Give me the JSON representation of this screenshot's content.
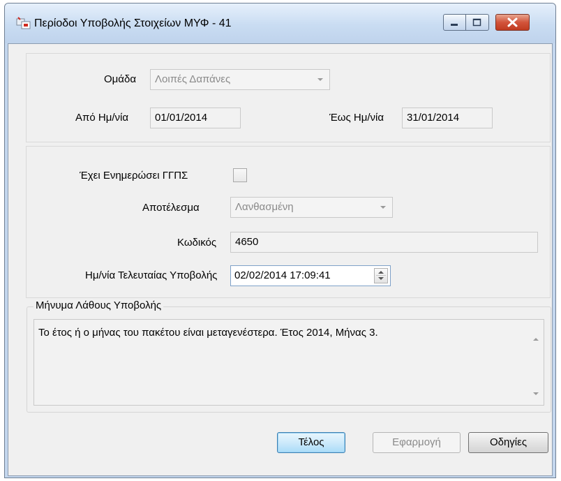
{
  "window": {
    "title": "Περίοδοι Υποβολής Στοιχείων ΜΥΦ - 41",
    "icons": {
      "app": "app-icon",
      "minimize": "minimize-icon",
      "maximize": "maximize-icon",
      "close": "close-icon"
    }
  },
  "period": {
    "group_label": "Ομάδα",
    "group_value": "Λοιπές Δαπάνες",
    "from_label": "Από Ημ/νία",
    "from_value": "01/01/2014",
    "to_label": "Έως Ημ/νία",
    "to_value": "31/01/2014"
  },
  "submission": {
    "updated_label": "Έχει Ενημερώσει ΓΓΠΣ",
    "updated_checked": false,
    "result_label": "Αποτέλεσμα",
    "result_value": "Λανθασμένη",
    "code_label": "Κωδικός",
    "code_value": "4650",
    "last_date_label": "Ημ/νία Τελευταίας Υποβολής",
    "last_date_value": "02/02/2014 17:09:41"
  },
  "error": {
    "legend": "Μήνυμα Λάθους Υποβολής",
    "message": "Το έτος ή ο μήνας του πακέτου είναι μεταγενέστερα. Έτος 2014, Μήνας 3."
  },
  "buttons": {
    "finish": "Τέλος",
    "apply": "Εφαρμογή",
    "help": "Οδηγίες"
  },
  "colors": {
    "titlebar": "#c9dcf2",
    "client": "#f0f0f0",
    "close_button": "#c9462c",
    "default_button": "#cdeafb"
  }
}
